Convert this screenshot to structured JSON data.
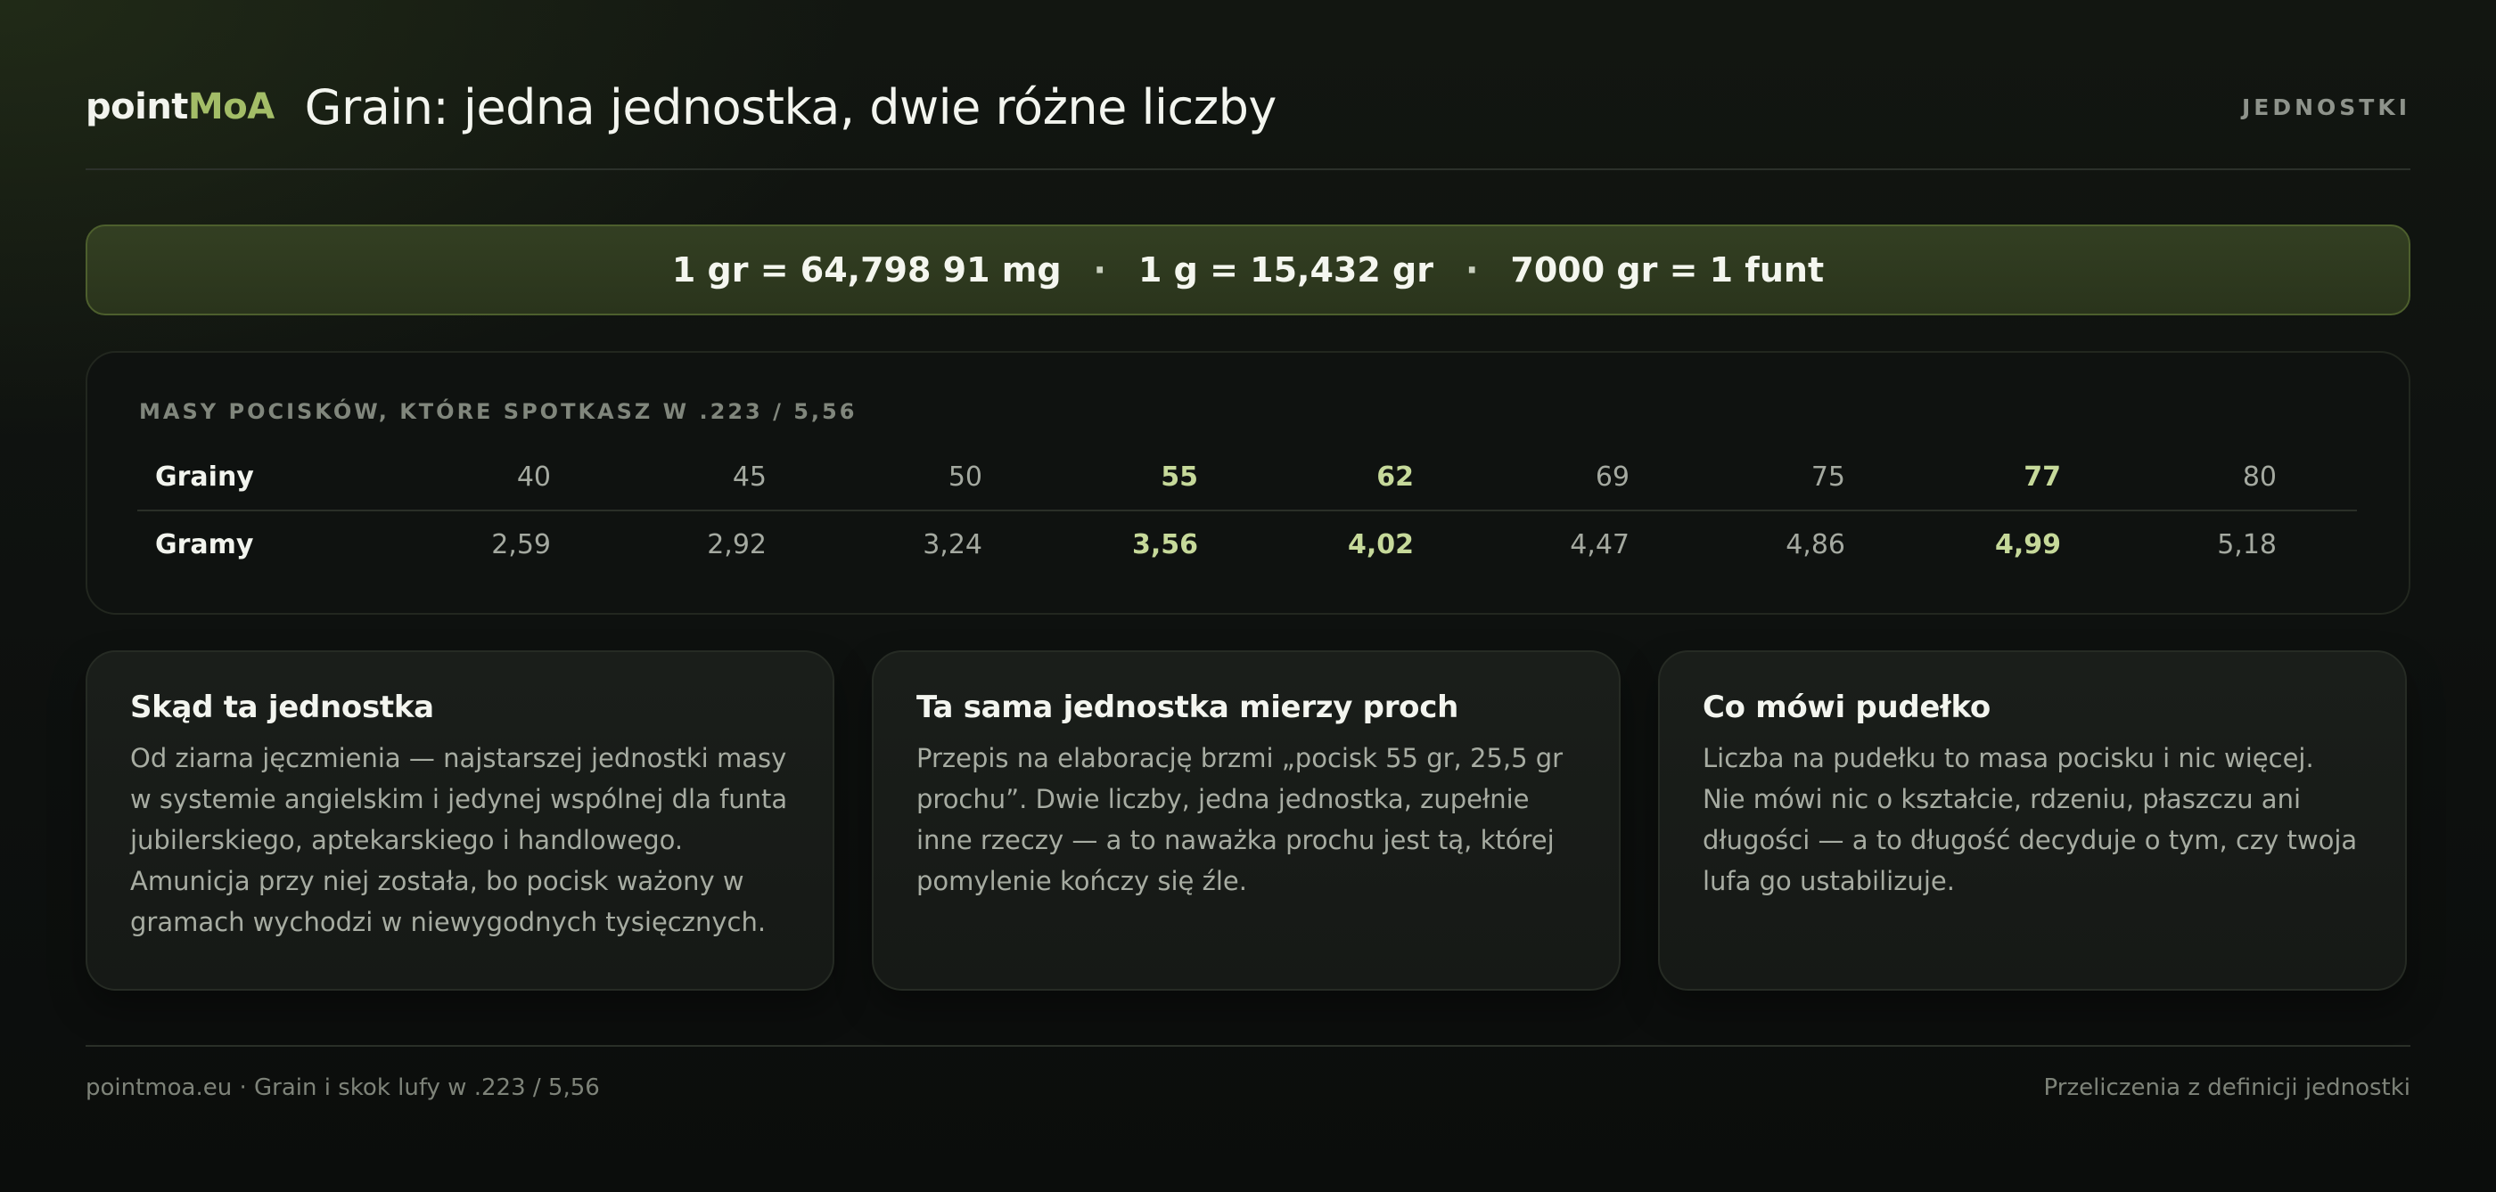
{
  "header": {
    "logo_part1": "point",
    "logo_part2": "MoA",
    "title": "Grain: jedna jednostka, dwie różne liczby",
    "section_tag": "JEDNOSTKI"
  },
  "banner": {
    "items": [
      "1 gr = 64,798 91 mg",
      "1 g = 15,432 gr",
      "7000 gr = 1 funt"
    ],
    "separator": "·"
  },
  "masses_table": {
    "heading": "MASY POCISKÓW, KTÓRE SPOTKASZ W .223 / 5,56",
    "rows": [
      {
        "label": "Grainy",
        "values": [
          "40",
          "45",
          "50",
          "55",
          "62",
          "69",
          "75",
          "77",
          "80"
        ]
      },
      {
        "label": "Gramy",
        "values": [
          "2,59",
          "2,92",
          "3,24",
          "3,56",
          "4,02",
          "4,47",
          "4,86",
          "4,99",
          "5,18"
        ]
      }
    ],
    "highlighted_columns": [
      3,
      4,
      7
    ]
  },
  "cards": [
    {
      "title": "Skąd ta jednostka",
      "body": "Od ziarna jęczmienia — najstarszej jednostki masy w systemie angielskim i jedynej wspólnej dla funta jubilerskiego, aptekarskiego i handlowego. Amunicja przy niej została, bo pocisk ważony w gramach wychodzi w niewygodnych tysięcznych."
    },
    {
      "title": "Ta sama jednostka mierzy proch",
      "body": "Przepis na elaborację brzmi „pocisk 55 gr, 25,5 gr prochu”. Dwie liczby, jedna jednostka, zupełnie inne rzeczy — a to naważka prochu jest tą, której pomylenie kończy się źle."
    },
    {
      "title": "Co mówi pudełko",
      "body": "Liczba na pudełku to masa pocisku i nic więcej. Nie mówi nic o kształcie, rdzeniu, płaszczu ani długości — a to długość decyduje o tym, czy twoja lufa go ustabilizuje."
    }
  ],
  "footer": {
    "left": "pointmoa.eu · Grain i skok lufy w .223 / 5,56",
    "right": "Przeliczenia z definicji jednostki"
  },
  "colors": {
    "accent": "#a3bd67",
    "highlight": "#c6d99a",
    "banner_bg": "#2f3a1f",
    "background": "#0e110f"
  }
}
